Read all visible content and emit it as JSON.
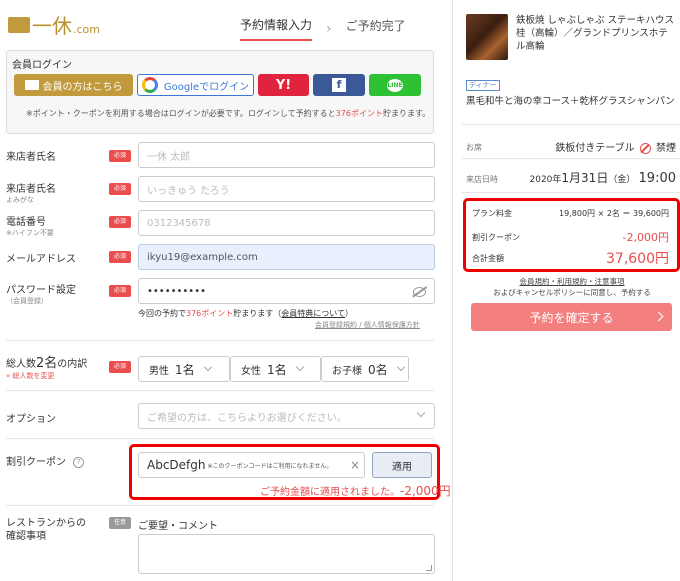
{
  "header": {
    "logo_text": "一休",
    "logo_com": ".com",
    "step_active": "予約情報入力",
    "step_next": "ご予約完了"
  },
  "login": {
    "title": "会員ログイン",
    "member_button": "会員の方はこちら",
    "google_button": "Googleでログイン",
    "yahoo_button": "Y!",
    "facebook_button": "f",
    "line_button": "LINE",
    "note_prefix": "※ポイント・クーポンを利用する場合はログインが必要です。ログインして予約すると",
    "note_points": "376ポイント",
    "note_suffix": "貯まります。"
  },
  "form": {
    "required_badge": "必須",
    "optional_badge": "任意",
    "name": {
      "label": "来店者氏名",
      "placeholder": "一休 太郎"
    },
    "kana": {
      "label": "来店者氏名",
      "sub": "よみがな",
      "placeholder": "いっきゅう たろう"
    },
    "phone": {
      "label": "電話番号",
      "sub": "※ハイフン不要",
      "placeholder": "0312345678"
    },
    "email": {
      "label": "メールアドレス",
      "value": "ikyu19@example.com"
    },
    "password": {
      "label": "パスワード設定",
      "sub": "（会員登録）",
      "value": "••••••••••",
      "note_prefix": "今回の予約で",
      "note_points": "376ポイント",
      "note_mid": "貯まります（",
      "note_link": "会員特典について",
      "note_end": "）",
      "terms": "会員登録規約 / 個人情報保護方針"
    },
    "party": {
      "label_prefix": "総人数",
      "count": "2名",
      "label_suffix": "の内訳",
      "sub": "» 総人数を変更",
      "male_label": "男性",
      "male_value": "1名",
      "female_label": "女性",
      "female_value": "1名",
      "child_label": "お子様",
      "child_value": "0名"
    },
    "option": {
      "label": "オプション",
      "placeholder": "ご希望の方は、こちらよりお選びください。"
    },
    "coupon": {
      "label": "割引クーポン",
      "help": "?",
      "value": "AbcDefgh",
      "note": "※このクーポンコードはご利用になれません。",
      "clear": "×",
      "apply_button": "適用",
      "applied_msg": "ご予約金額に適用されました。",
      "applied_amount": "-2,000円"
    },
    "comment": {
      "label_line1": "レストランからの",
      "label_line2": "確認事項",
      "title": "ご要望・コメント"
    }
  },
  "summary": {
    "restaurant": "鉄板焼 しゃぶしゃぶ ステーキハウス 桂（高輪）／グランドプリンスホテル高輪",
    "tag": "ディナー",
    "course": "黒毛和牛と海の幸コース＋乾杯グラスシャンパン",
    "seat_label": "お席",
    "seat_value": "鉄板付きテーブル",
    "smoking": "禁煙",
    "date_label": "来店日時",
    "date_prefix": "2020年",
    "date_month": "1月",
    "date_day": "31日",
    "date_weekday": "（金）",
    "date_time": "19:00",
    "plan_label": "プラン料金",
    "plan_value": "19,800円 × 2名 ＝ 39,600円",
    "coupon_label": "割引クーポン",
    "coupon_value": "-2,000円",
    "total_label": "合計金額",
    "total_value": "37,600円",
    "terms_line1": "会員規約・利用規約・注意事項",
    "terms_line2": "およびキャンセルポリシーに同意し、予約する",
    "confirm_button": "予約を確定する"
  },
  "colors": {
    "brand_gold": "#c09a3c",
    "accent_red": "#e94d4d",
    "highlight_border": "#e00000",
    "confirm_button": "#f47f7f"
  },
  "icons": [
    "logo-icon",
    "google-icon",
    "yahoo-icon",
    "facebook-icon",
    "line-icon",
    "eye-icon",
    "chevron-down-icon",
    "close-icon",
    "help-icon",
    "no-smoking-icon",
    "chevron-right-icon"
  ]
}
